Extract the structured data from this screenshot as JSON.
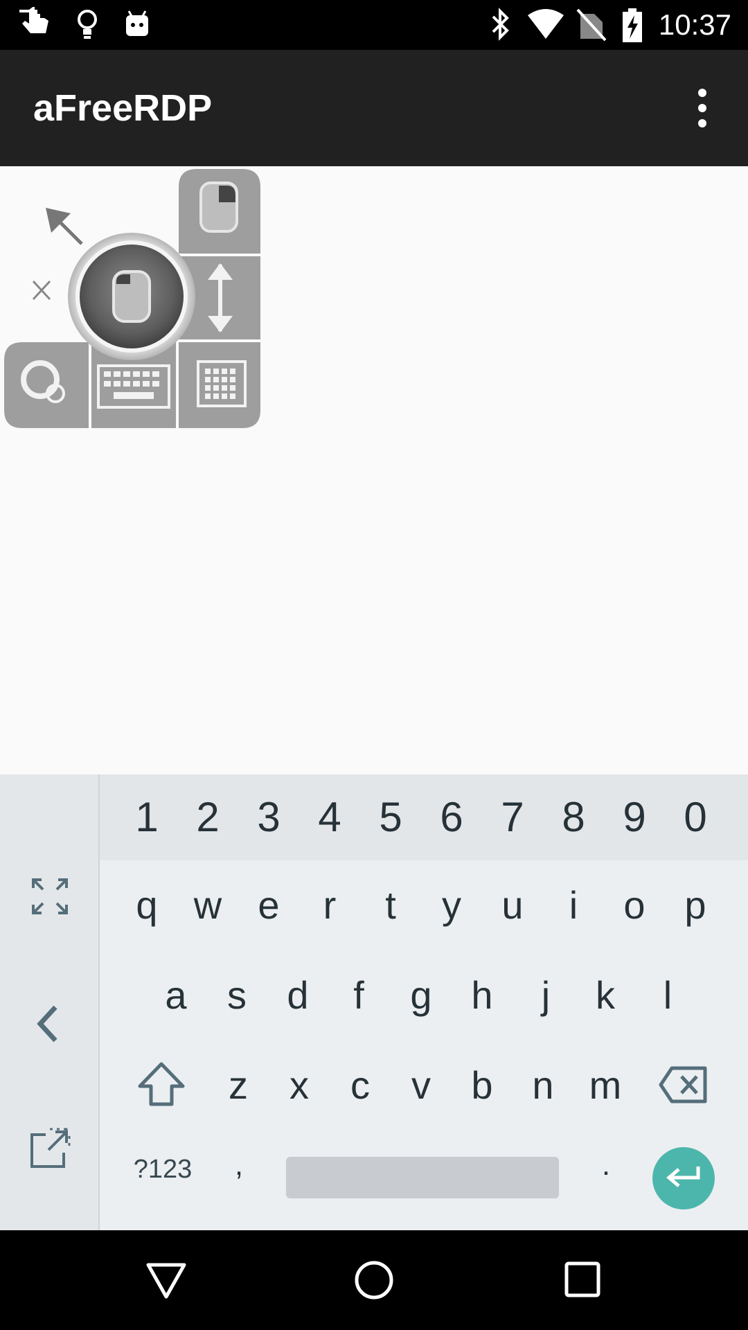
{
  "status_bar": {
    "time": "10:37",
    "left_icons": [
      "touch-icon",
      "lightbulb-icon",
      "android-icon"
    ],
    "right_icons": [
      "bluetooth-icon",
      "wifi-icon",
      "no-sim-icon",
      "battery-charging-icon"
    ]
  },
  "app_bar": {
    "title": "aFreeRDP",
    "overflow_icon": "more-vert-icon"
  },
  "touchpointer": {
    "icons": [
      "mouse-right-click-icon",
      "move-arrow-icon",
      "close-x-icon",
      "mouse-left-click-icon",
      "scroll-updown-icon",
      "zoom-icon",
      "keyboard-icon",
      "extended-keyboard-icon"
    ]
  },
  "keyboard": {
    "number_row": [
      "1",
      "2",
      "3",
      "4",
      "5",
      "6",
      "7",
      "8",
      "9",
      "0"
    ],
    "row1": [
      "q",
      "w",
      "e",
      "r",
      "t",
      "y",
      "u",
      "i",
      "o",
      "p"
    ],
    "row2": [
      "a",
      "s",
      "d",
      "f",
      "g",
      "h",
      "j",
      "k",
      "l"
    ],
    "row3": [
      "z",
      "x",
      "c",
      "v",
      "b",
      "n",
      "m"
    ],
    "symbols_label": "?123",
    "comma_label": ",",
    "period_label": ".",
    "side_icons": [
      "fullscreen-icon",
      "back-chevron-icon",
      "open-external-icon"
    ],
    "colors": {
      "enter": "#4db6ac",
      "space": "#c8ccd0",
      "background": "#eceff1"
    }
  },
  "nav_bar": {
    "icons": [
      "back-triangle-icon",
      "home-circle-icon",
      "recents-square-icon"
    ]
  }
}
